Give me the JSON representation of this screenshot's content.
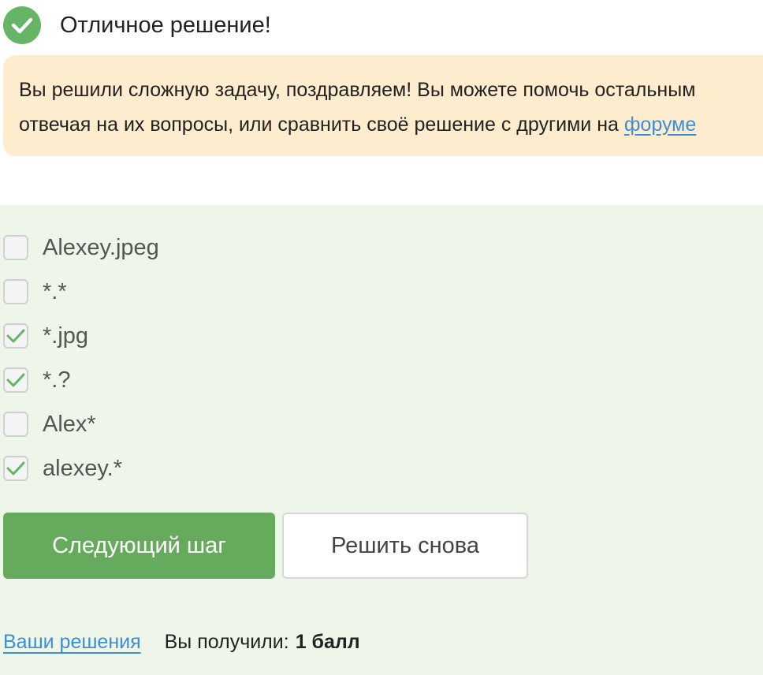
{
  "result": {
    "icon": "check-circle-icon",
    "title": "Отличное решение!",
    "accent_color": "#66b466"
  },
  "notice": {
    "line1": "Вы решили сложную задачу, поздравляем! Вы можете помочь остальным",
    "line2_prefix": "отвечая на их вопросы, или сравнить своё решение с другими на ",
    "forum_link": "форуме",
    "background": "#fdeccd"
  },
  "quiz": {
    "options": [
      {
        "label": "Alexey.jpeg",
        "checked": false
      },
      {
        "label": "*.*",
        "checked": false
      },
      {
        "label": "*.jpg",
        "checked": true
      },
      {
        "label": "*.?",
        "checked": true
      },
      {
        "label": "Alex*",
        "checked": false
      },
      {
        "label": "alexey.*",
        "checked": true
      }
    ]
  },
  "buttons": {
    "next": "Следующий шаг",
    "retry": "Решить снова"
  },
  "footer": {
    "solutions_link": "Ваши решения",
    "score_prefix": "Вы получили:",
    "score_value": "1 балл"
  }
}
